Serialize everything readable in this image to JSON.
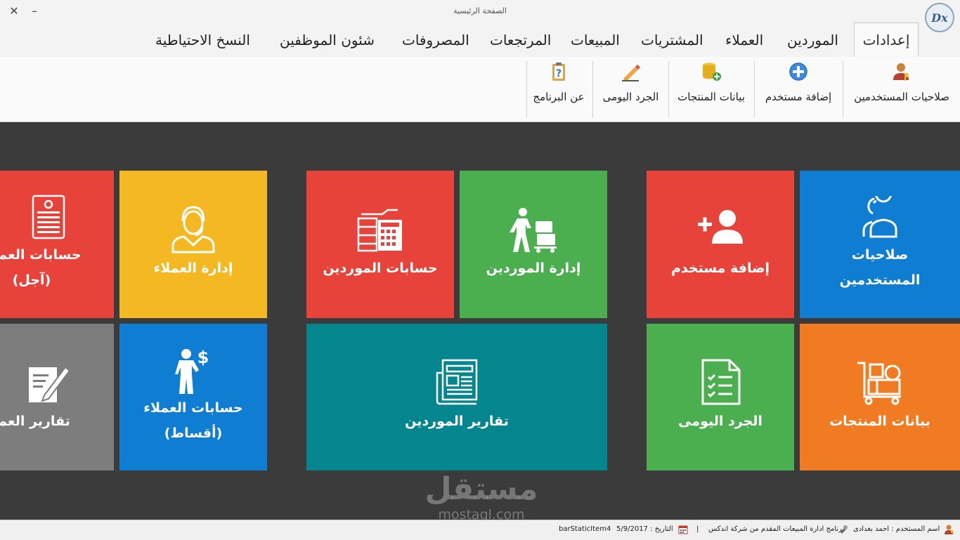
{
  "window": {
    "title": "الصفحة الرئيسية",
    "close_glyph": "✕",
    "minimize_glyph": "–",
    "logo_text": "Dx"
  },
  "tabs": [
    {
      "label": "إعدادات",
      "active": true
    },
    {
      "label": "الموردين"
    },
    {
      "label": "العملاء"
    },
    {
      "label": "المشتريات"
    },
    {
      "label": "المبيعات"
    },
    {
      "label": "المرتجعات"
    },
    {
      "label": "المصروفات"
    },
    {
      "label": "شئون الموظفين"
    },
    {
      "label": "النسخ الاحتياطية"
    }
  ],
  "ribbon": {
    "items": [
      {
        "label": "صلاحيات المستخدمين",
        "icon": "user-key-icon"
      },
      {
        "label": "إضافة مستخدم",
        "icon": "add-circle-icon"
      },
      {
        "label": "بيانات المنتجات",
        "icon": "database-add-icon"
      },
      {
        "label": "الجرد اليومى",
        "icon": "pencil-icon"
      },
      {
        "label": "عن البرنامج",
        "icon": "help-clipboard-icon"
      }
    ]
  },
  "tiles": {
    "user_permissions": {
      "label": "صلاحيات\nالمستخدمين",
      "color": "#0f7dd1",
      "icon": "users-icon"
    },
    "add_user": {
      "label": "إضافة مستخدم",
      "color": "#e8433a",
      "icon": "add-user-icon"
    },
    "supplier_management": {
      "label": "إدارة الموردين",
      "color": "#4bae4f",
      "icon": "porter-luggage-icon"
    },
    "supplier_accounts": {
      "label": "حسابات الموردين",
      "color": "#e8433a",
      "icon": "ledger-calculator-icon"
    },
    "customer_management": {
      "label": "إدارة العملاء",
      "color": "#f4b922",
      "icon": "headset-agent-icon"
    },
    "customer_accounts_credit": {
      "label": "حسابات العملاء\n(آجل)",
      "color": "#e8433a",
      "icon": "invoice-icon"
    },
    "product_data": {
      "label": "بيانات المنتجات",
      "color": "#f07b22",
      "icon": "cart-boxes-icon"
    },
    "daily_inventory": {
      "label": "الجرد اليومى",
      "color": "#4bae4f",
      "icon": "checklist-icon"
    },
    "supplier_reports": {
      "label": "تقارير الموردين",
      "color": "#05858e",
      "icon": "newspaper-icon"
    },
    "customer_accounts_installments": {
      "label": "حسابات العملاء\n(أقساط)",
      "color": "#0f7dd1",
      "icon": "man-dollar-icon"
    },
    "customer_reports": {
      "label": "تقارير العملاء",
      "color": "#7d7d7d",
      "icon": "edit-document-icon"
    }
  },
  "watermark": {
    "arabic": "مستقل",
    "latin": "mostaql.com"
  },
  "statusbar": {
    "user": "اسم المستخدم : احمد بغدادى",
    "program": "برنامج ادارة المبيعات المقدم من شركة اندكس",
    "separator": "|",
    "date": "التاريخ : 5/9/2017",
    "static_item": "barStaticItem4"
  }
}
